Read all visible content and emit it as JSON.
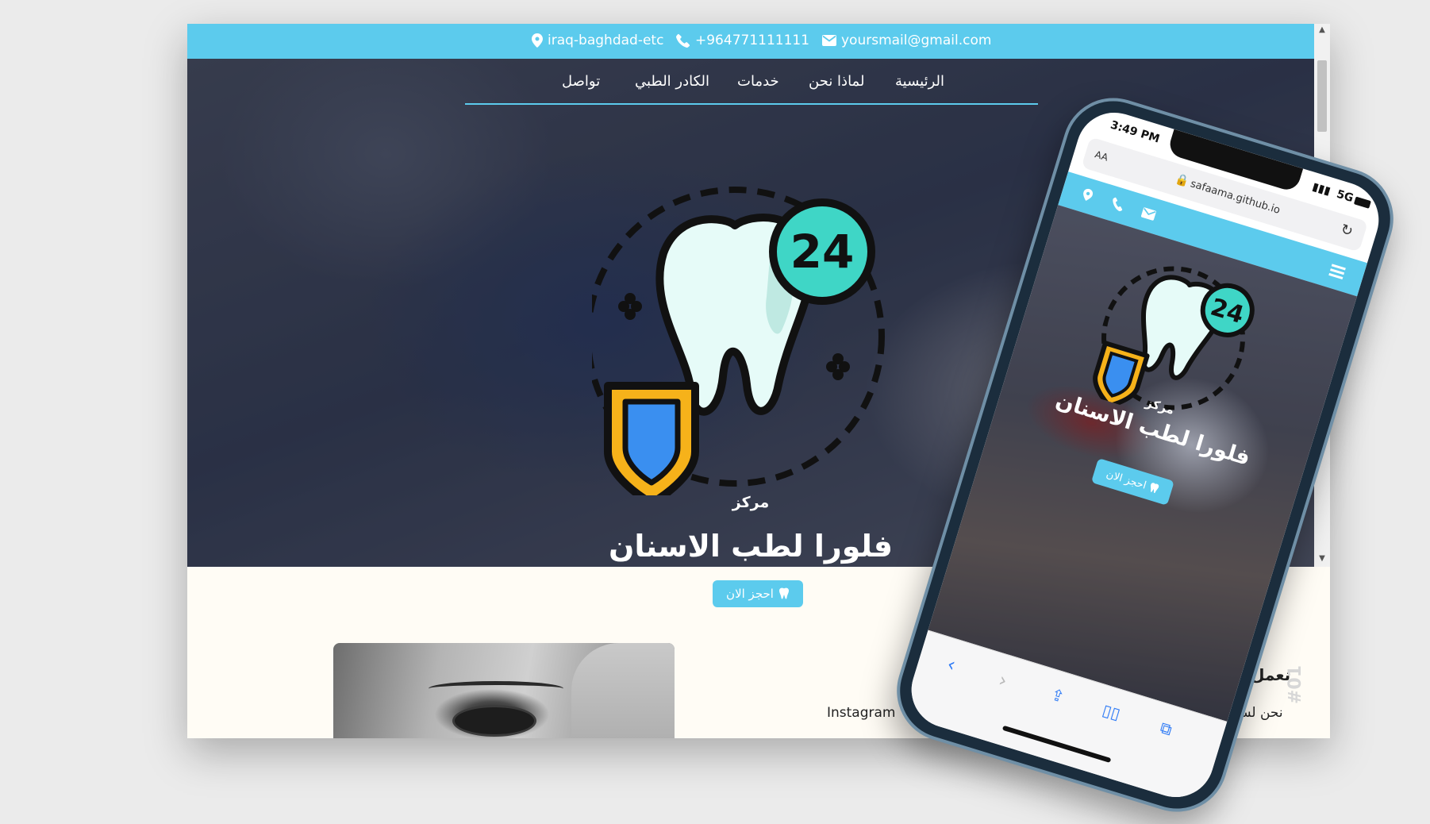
{
  "topbar": {
    "location": "iraq-baghdad-etc",
    "phone": "+964771111111",
    "email": "yoursmail@gmail.com"
  },
  "nav": {
    "items": [
      "الرئيسية",
      "لماذا نحن",
      "خدمات",
      "الكادر الطبي",
      "تواصل"
    ]
  },
  "hero": {
    "badge_number": "24",
    "subtitle": "مركز",
    "title": "فلورا لطب الاسنان"
  },
  "booking": {
    "button_label": "احجز الان"
  },
  "section": {
    "number": "#01",
    "title": "نعمل عا",
    "text": "نحن لسنا م",
    "instagram": "Instagram"
  },
  "phone": {
    "time": "3:49 PM",
    "network": "5G",
    "text_size": "AA",
    "url": "safaama.github.io",
    "badge_number": "24",
    "subtitle": "مركز",
    "title": "فلورا لطب الاسنان",
    "button_label": "احجز الان"
  },
  "colors": {
    "accent": "#5ccbed",
    "page_bg": "#fffcf5",
    "tooth": "#e6fbf8",
    "badge": "#3fd6c6",
    "shield_outer": "#f6b21a",
    "shield_inner": "#3a8ff0"
  }
}
